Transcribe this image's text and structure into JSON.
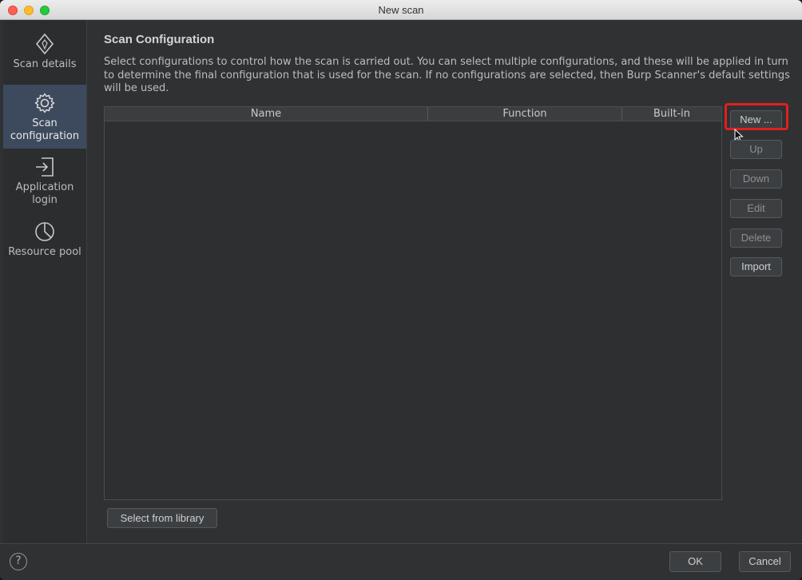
{
  "window": {
    "title": "New scan"
  },
  "sidebar": {
    "items": [
      {
        "label": "Scan details",
        "icon": "scan-details-icon",
        "active": false
      },
      {
        "label": "Scan configuration",
        "icon": "gear-icon",
        "active": true
      },
      {
        "label": "Application login",
        "icon": "login-icon",
        "active": false
      },
      {
        "label": "Resource pool",
        "icon": "pie-chart-icon",
        "active": false
      }
    ]
  },
  "main": {
    "title": "Scan Configuration",
    "description": "Select configurations to control how the scan is carried out. You can select multiple configurations, and these will be applied in turn to determine the final configuration that is used for the scan. If no configurations are selected, then Burp Scanner's default settings will be used.",
    "table": {
      "columns": [
        "Name",
        "Function",
        "Built-in"
      ],
      "rows": []
    },
    "buttons": {
      "new": "New ...",
      "up": "Up",
      "down": "Down",
      "edit": "Edit",
      "delete": "Delete",
      "import": "Import",
      "select_library": "Select from library"
    }
  },
  "footer": {
    "ok": "OK",
    "cancel": "Cancel",
    "help": "?"
  },
  "colors": {
    "accent_active": "#3d4a5e",
    "highlight": "#e02020"
  }
}
